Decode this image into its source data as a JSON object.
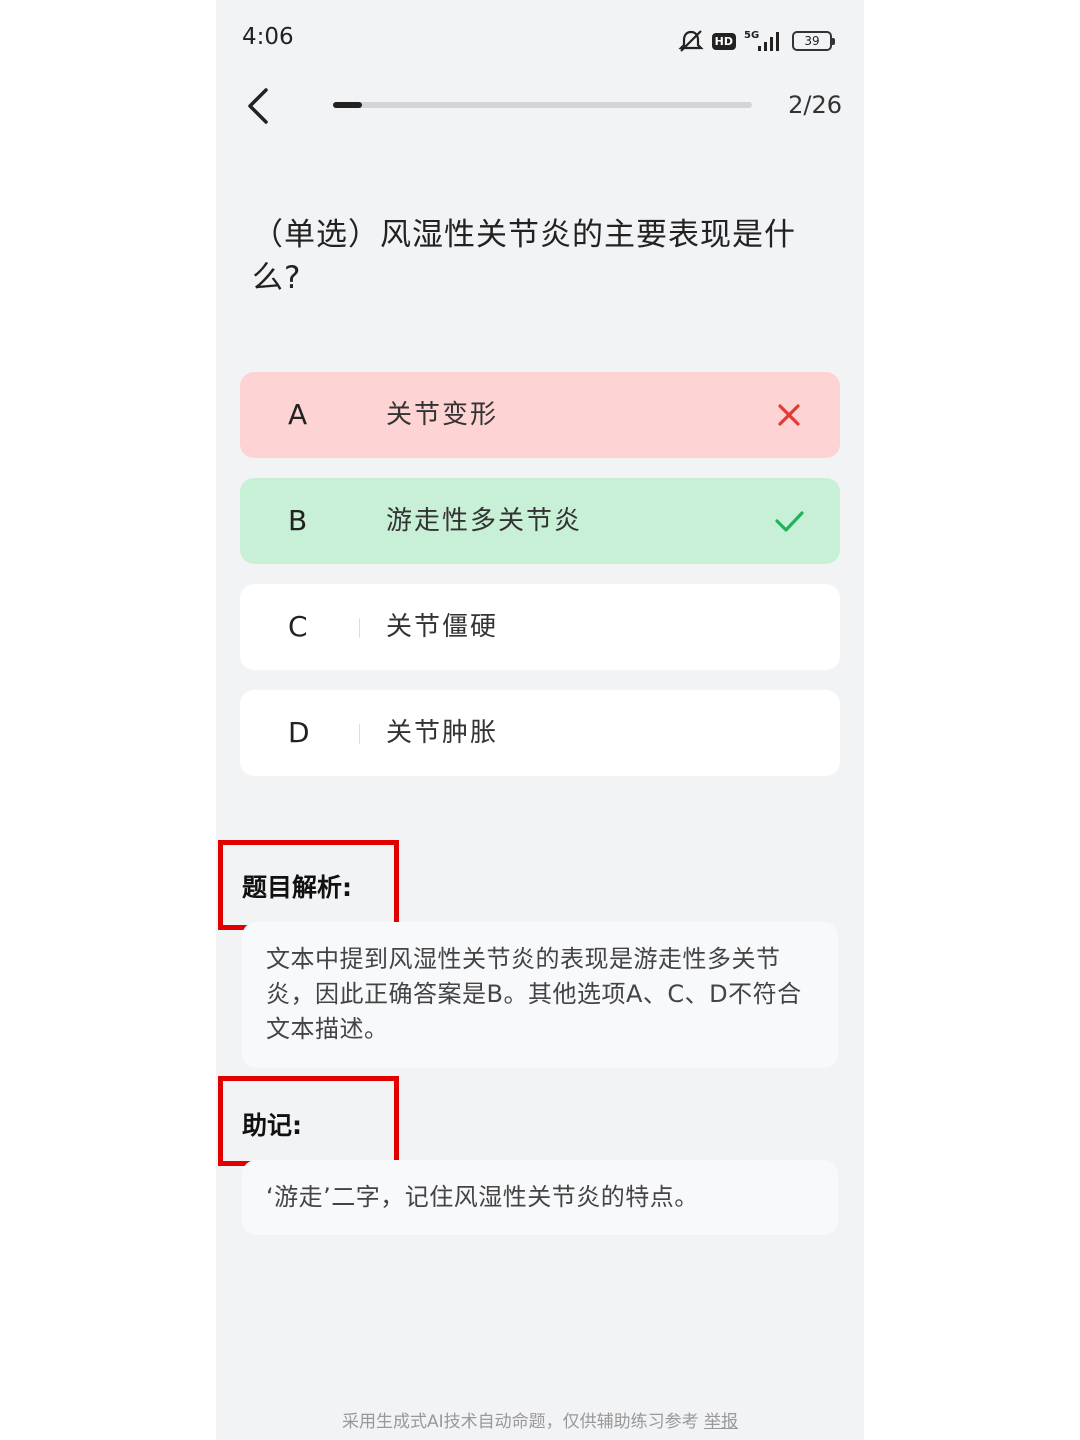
{
  "status_bar": {
    "time": "4:06",
    "hd": "HD",
    "network": "5G",
    "battery": "39"
  },
  "nav": {
    "progress_fraction": 0.069,
    "progress_text": "2/26"
  },
  "question": {
    "text": "（单选）风湿性关节炎的主要表现是什么?"
  },
  "options": [
    {
      "letter": "A",
      "text": "关节变形",
      "state": "wrong",
      "icon": "close-icon"
    },
    {
      "letter": "B",
      "text": "游走性多关节炎",
      "state": "correct",
      "icon": "check-icon"
    },
    {
      "letter": "C",
      "text": "关节僵硬",
      "state": "neutral"
    },
    {
      "letter": "D",
      "text": "关节肿胀",
      "state": "neutral"
    }
  ],
  "analysis": {
    "title": "题目解析:",
    "body": "文本中提到风湿性关节炎的表现是游走性多关节炎，因此正确答案是B。其他选项A、C、D不符合文本描述。"
  },
  "mnemonic": {
    "title": "助记:",
    "body": "‘游走’二字，记住风湿性关节炎的特点。"
  },
  "footer": {
    "text": "采用生成式AI技术自动命题，仅供辅助练习参考",
    "report": "举报"
  },
  "colors": {
    "wrong": "#e53935",
    "correct": "#21b35c",
    "highlight_box": "#e00000"
  }
}
